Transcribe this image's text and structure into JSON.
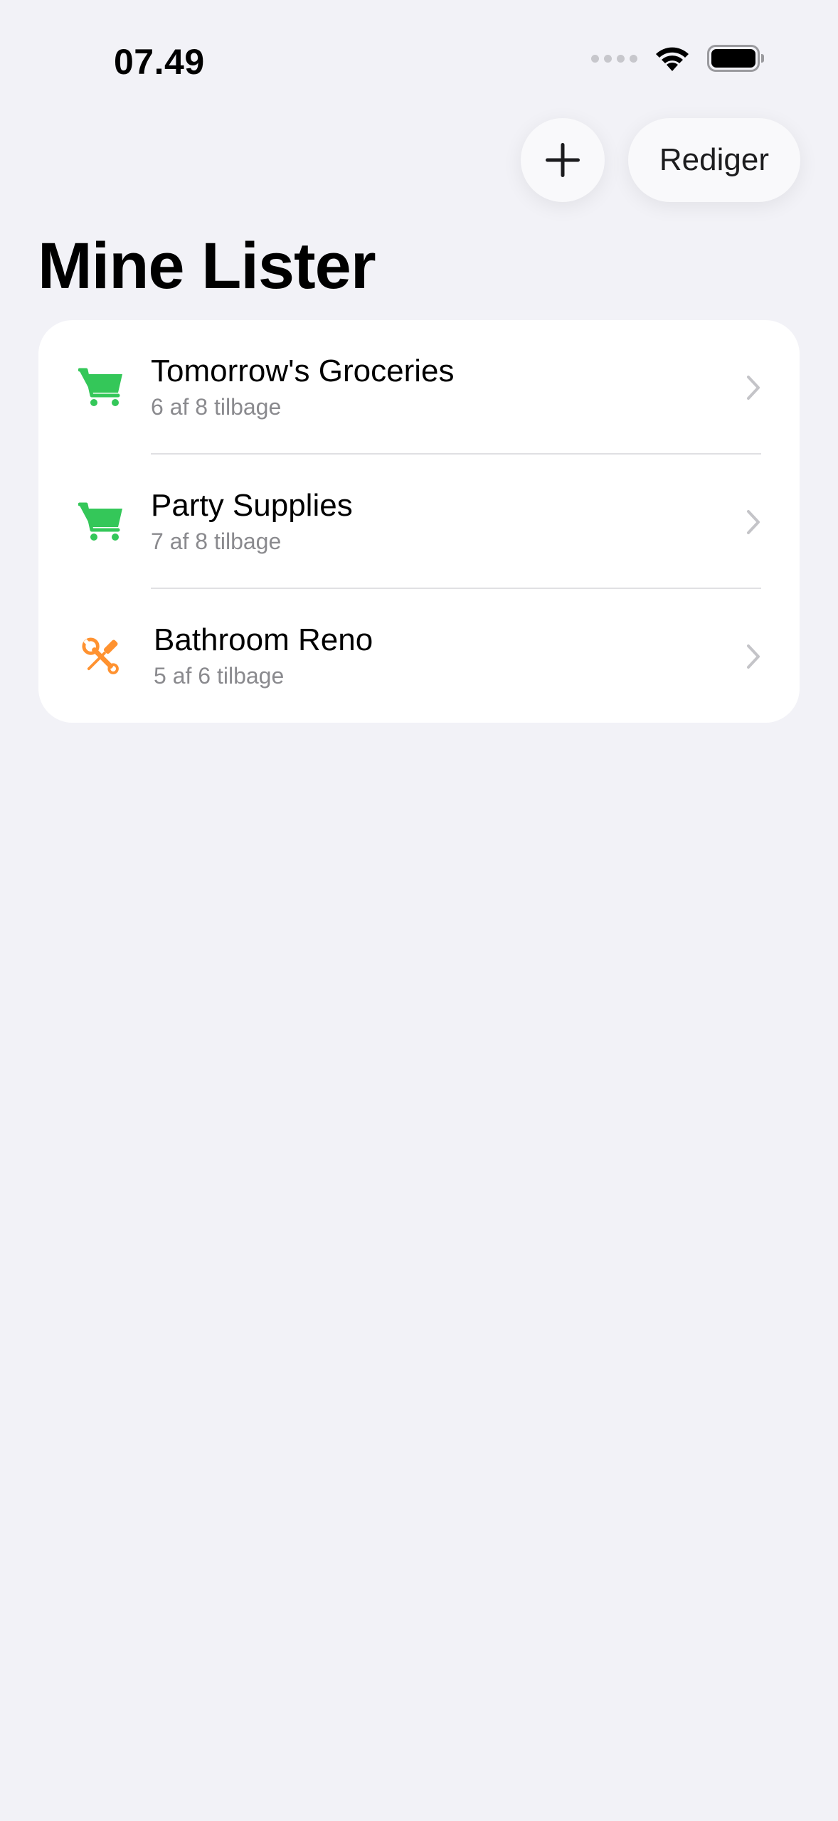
{
  "status_bar": {
    "time": "07.49"
  },
  "toolbar": {
    "add_icon": "plus-icon",
    "edit_label": "Rediger"
  },
  "page": {
    "title": "Mine Lister"
  },
  "lists": [
    {
      "title": "Tomorrow's Groceries",
      "subtitle": "6 af 8 tilbage",
      "icon": "cart-icon",
      "icon_color": "#34c759"
    },
    {
      "title": "Party Supplies",
      "subtitle": "7 af 8 tilbage",
      "icon": "cart-icon",
      "icon_color": "#34c759"
    },
    {
      "title": "Bathroom Reno",
      "subtitle": "5 af 6 tilbage",
      "icon": "tools-icon",
      "icon_color": "#ff9230"
    }
  ]
}
